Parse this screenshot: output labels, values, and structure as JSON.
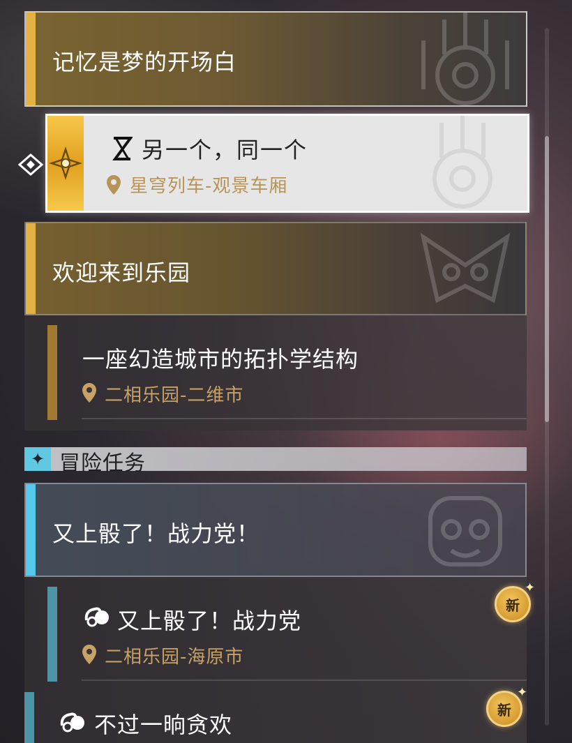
{
  "quests": {
    "main_title_1": "记忆是梦的开场白",
    "selected": {
      "title": "另一个，同一个",
      "location": "星穹列车-观景车厢",
      "quest_icon": "hourglass-icon"
    },
    "main_title_2": "欢迎来到乐园",
    "sub_2": {
      "title": "一座幻造城市的拓扑学结构",
      "location": "二相乐园-二维市"
    }
  },
  "adventure": {
    "header_label": "冒险任务",
    "header_icon": "sparkle-icon",
    "main_title": "又上骰了！战力党！",
    "sub_1": {
      "title": "又上骰了！战力党",
      "location": "二相乐园-海原市",
      "badge": "新"
    },
    "sub_2": {
      "title": "不过一晌贪欢",
      "badge": "新"
    }
  },
  "colors": {
    "gold_accent": "#e4b244",
    "blue_accent": "#55c9ec",
    "location_text": "#c7a266"
  }
}
